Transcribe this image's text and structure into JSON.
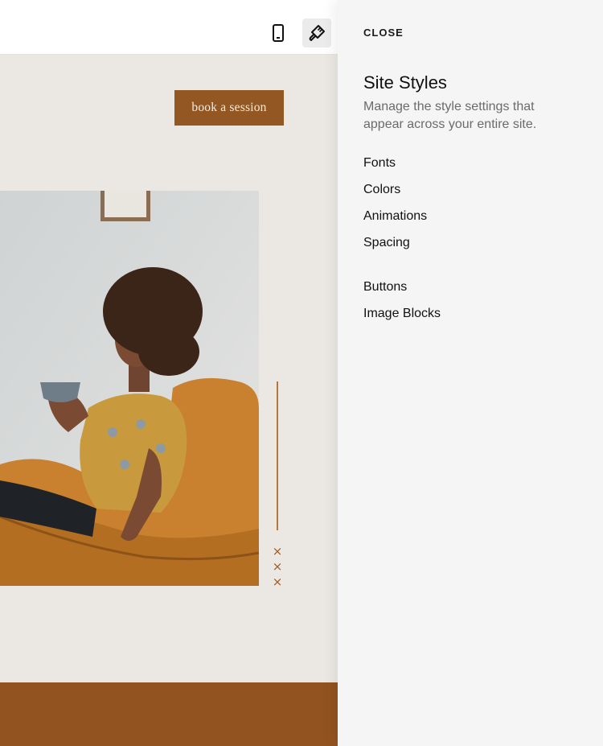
{
  "toolbar": {
    "mobile_icon": "mobile-phone-icon",
    "styles_icon": "paintbrush-icon"
  },
  "site": {
    "cta_label": "book a session",
    "accent_color": "#925722",
    "background_color": "#ebe8e3",
    "decor_marks": [
      "×",
      "×",
      "×"
    ]
  },
  "panel": {
    "close_label": "CLOSE",
    "title": "Site Styles",
    "description": "Manage the style settings that appear across your entire site.",
    "items": [
      {
        "label": "Fonts"
      },
      {
        "label": "Colors"
      },
      {
        "label": "Animations"
      },
      {
        "label": "Spacing"
      },
      {
        "label": "Buttons"
      },
      {
        "label": "Image Blocks"
      }
    ]
  }
}
